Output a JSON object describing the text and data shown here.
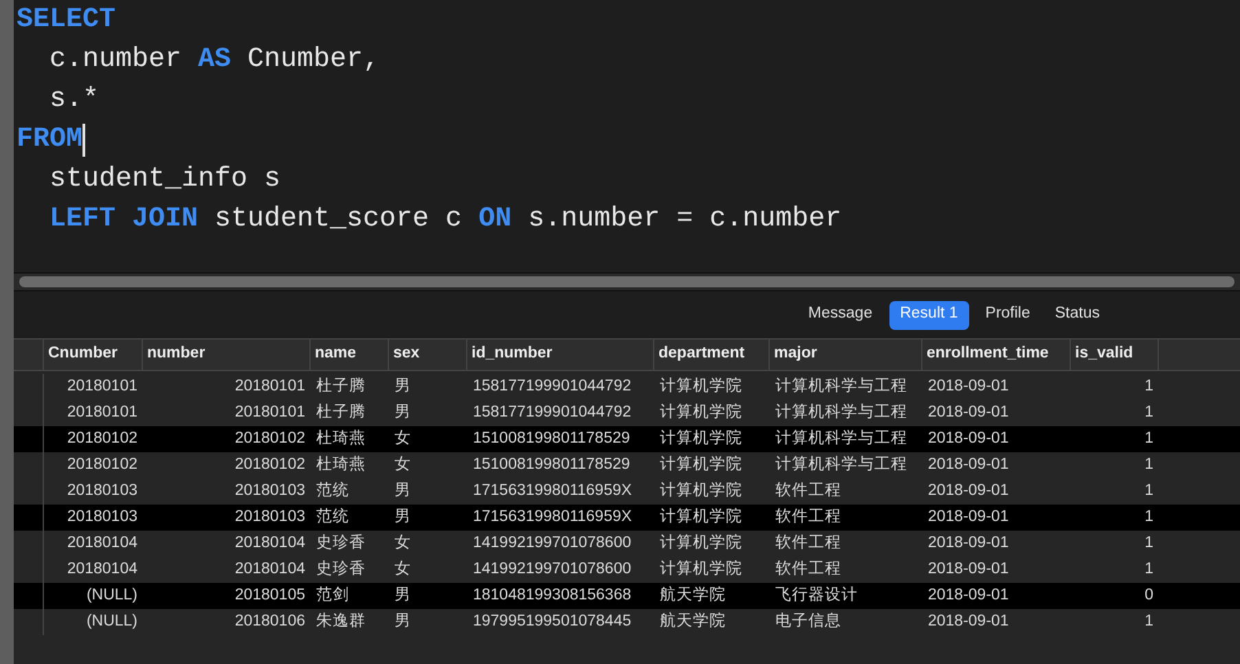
{
  "editor": {
    "lines": [
      {
        "cursor": false,
        "tokens": [
          {
            "kind": "keyword",
            "text": "SELECT"
          }
        ],
        "children": [
          {
            "cursor": false,
            "tokens": [
              {
                "kind": "text",
                "text": "c.number "
              },
              {
                "kind": "keyword",
                "text": "AS"
              },
              {
                "kind": "text",
                "text": " Cnumber,"
              }
            ]
          },
          {
            "cursor": false,
            "tokens": [
              {
                "kind": "text",
                "text": "s.*"
              }
            ]
          }
        ]
      },
      {
        "cursor": true,
        "tokens": [
          {
            "kind": "keyword",
            "text": "FROM"
          }
        ],
        "children": [
          {
            "cursor": false,
            "tokens": [
              {
                "kind": "text",
                "text": "student_info s"
              }
            ]
          },
          {
            "cursor": false,
            "tokens": [
              {
                "kind": "keyword",
                "text": "LEFT JOIN"
              },
              {
                "kind": "text",
                "text": " student_score c "
              },
              {
                "kind": "keyword",
                "text": "ON"
              },
              {
                "kind": "text",
                "text": " s.number = c.number"
              }
            ]
          }
        ]
      }
    ]
  },
  "tabs": [
    {
      "label": "Message",
      "selected": false
    },
    {
      "label": "Result 1",
      "selected": true
    },
    {
      "label": "Profile",
      "selected": false
    },
    {
      "label": "Status",
      "selected": false
    }
  ],
  "table": {
    "columns": [
      {
        "label": "Cnumber",
        "kind": "number"
      },
      {
        "label": "number",
        "kind": "number"
      },
      {
        "label": "name",
        "kind": "text"
      },
      {
        "label": "sex",
        "kind": "text"
      },
      {
        "label": "id_number",
        "kind": "text"
      },
      {
        "label": "department",
        "kind": "text"
      },
      {
        "label": "major",
        "kind": "text"
      },
      {
        "label": "enrollment_time",
        "kind": "text"
      },
      {
        "label": "is_valid",
        "kind": "number"
      }
    ],
    "rows": [
      {
        "highlighted": false,
        "cells": [
          "20180101",
          "20180101",
          "杜子腾",
          "男",
          "158177199901044792",
          "计算机学院",
          "计算机科学与工程",
          "2018-09-01",
          "1"
        ]
      },
      {
        "highlighted": false,
        "cells": [
          "20180101",
          "20180101",
          "杜子腾",
          "男",
          "158177199901044792",
          "计算机学院",
          "计算机科学与工程",
          "2018-09-01",
          "1"
        ]
      },
      {
        "highlighted": true,
        "cells": [
          "20180102",
          "20180102",
          "杜琦燕",
          "女",
          "151008199801178529",
          "计算机学院",
          "计算机科学与工程",
          "2018-09-01",
          "1"
        ]
      },
      {
        "highlighted": false,
        "cells": [
          "20180102",
          "20180102",
          "杜琦燕",
          "女",
          "151008199801178529",
          "计算机学院",
          "计算机科学与工程",
          "2018-09-01",
          "1"
        ]
      },
      {
        "highlighted": false,
        "cells": [
          "20180103",
          "20180103",
          "范统",
          "男",
          "17156319980116959X",
          "计算机学院",
          "软件工程",
          "2018-09-01",
          "1"
        ]
      },
      {
        "highlighted": true,
        "cells": [
          "20180103",
          "20180103",
          "范统",
          "男",
          "17156319980116959X",
          "计算机学院",
          "软件工程",
          "2018-09-01",
          "1"
        ]
      },
      {
        "highlighted": false,
        "cells": [
          "20180104",
          "20180104",
          "史珍香",
          "女",
          "141992199701078600",
          "计算机学院",
          "软件工程",
          "2018-09-01",
          "1"
        ]
      },
      {
        "highlighted": false,
        "cells": [
          "20180104",
          "20180104",
          "史珍香",
          "女",
          "141992199701078600",
          "计算机学院",
          "软件工程",
          "2018-09-01",
          "1"
        ]
      },
      {
        "highlighted": true,
        "cells": [
          "(NULL)",
          "20180105",
          "范剑",
          "男",
          "181048199308156368",
          "航天学院",
          "飞行器设计",
          "2018-09-01",
          "0"
        ]
      },
      {
        "highlighted": false,
        "cells": [
          "(NULL)",
          "20180106",
          "朱逸群",
          "男",
          "197995199501078445",
          "航天学院",
          "电子信息",
          "2018-09-01",
          "1"
        ]
      }
    ]
  }
}
